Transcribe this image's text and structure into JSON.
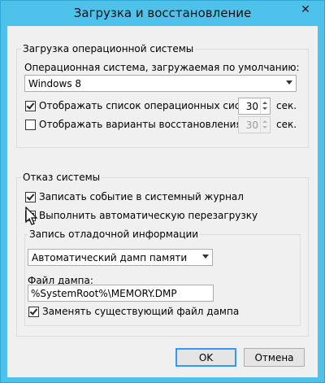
{
  "window": {
    "title": "Загрузка и восстановление",
    "close_symbol": "✕"
  },
  "startup": {
    "group_title": "Загрузка операционной системы",
    "default_os_label": "Операционная система, загружаемая по умолчанию:",
    "default_os_value": "Windows 8",
    "show_os_list": {
      "label": "Отображать список операционных систем:",
      "checked": true,
      "value": "30",
      "unit": "сек."
    },
    "show_recovery": {
      "label": "Отображать варианты восстановления:",
      "checked": false,
      "value": "30",
      "unit": "сек.",
      "enabled": false
    }
  },
  "failure": {
    "group_title": "Отказ системы",
    "write_event": {
      "label": "Записать событие в системный журнал",
      "checked": true
    },
    "auto_restart": {
      "label": "Выполнить автоматическую перезагрузку",
      "checked": true
    },
    "debug_group_title": "Запись отладочной информации",
    "dump_type": "Автоматический дамп памяти",
    "dump_file_label": "Файл дампа:",
    "dump_file_value": "%SystemRoot%\\MEMORY.DMP",
    "overwrite": {
      "label": "Заменять существующий файл дампа",
      "checked": true
    }
  },
  "buttons": {
    "ok": "OK",
    "cancel": "Отмена"
  },
  "icons": {
    "close": "close-icon",
    "dropdown": "chevron-down-icon",
    "checkmark": "checkmark-icon",
    "cursor": "mouse-pointer-icon"
  }
}
